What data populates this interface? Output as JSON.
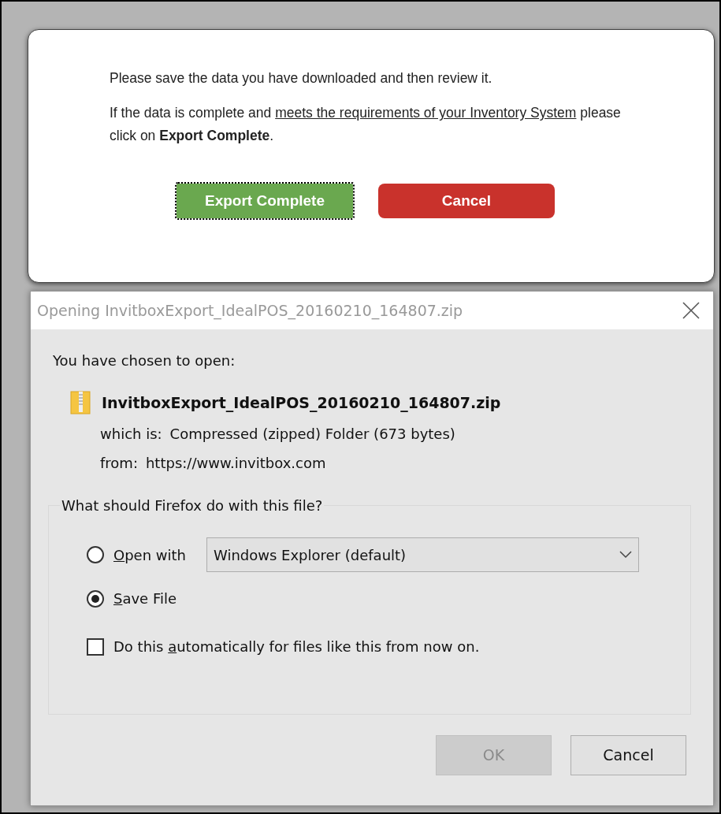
{
  "notice": {
    "message": "Please save the data you have downloaded and then review it.",
    "instruction": {
      "before": "If the data is complete and",
      "link": "meets the requirements of your Inventory System",
      "after": "please click on **Export Complete**."
    },
    "buttons": [
      {
        "label": "Export Complete",
        "kind": "confirm",
        "focused": true
      },
      {
        "label": "Cancel",
        "kind": "cancel",
        "focused": false
      }
    ]
  },
  "dialog": {
    "title": "Opening InvitboxExport_IdealPOS_20160210_164807.zip",
    "intro": "You have chosen to open:",
    "file_name": "InvitboxExport_IdealPOS_20160210_164807.zip",
    "details": [
      {
        "label": "which is:",
        "value": "Compressed (zipped) Folder (673 bytes)"
      },
      {
        "label": "from:",
        "value": "https://www.invitbox.com"
      }
    ],
    "group_title": "What should Firefox do with this file?",
    "options": [
      {
        "kind": "radio",
        "parts": [
          {
            "text": "O",
            "underline": true
          },
          {
            "text": "pen with",
            "underline": false
          }
        ],
        "selected": false,
        "dropdown": "Windows Explorer (default)"
      },
      {
        "kind": "radio",
        "parts": [
          {
            "text": "S",
            "underline": true
          },
          {
            "text": "ave File",
            "underline": false
          }
        ],
        "selected": true
      },
      {
        "kind": "checkbox",
        "parts": [
          {
            "text": "Do this ",
            "underline": false
          },
          {
            "text": "a",
            "underline": true
          },
          {
            "text": "utomatically for files like this from now on.",
            "underline": false
          }
        ],
        "checked": false
      }
    ],
    "buttons": [
      {
        "label": "OK",
        "disabled": true
      },
      {
        "label": "Cancel",
        "disabled": false
      }
    ]
  }
}
